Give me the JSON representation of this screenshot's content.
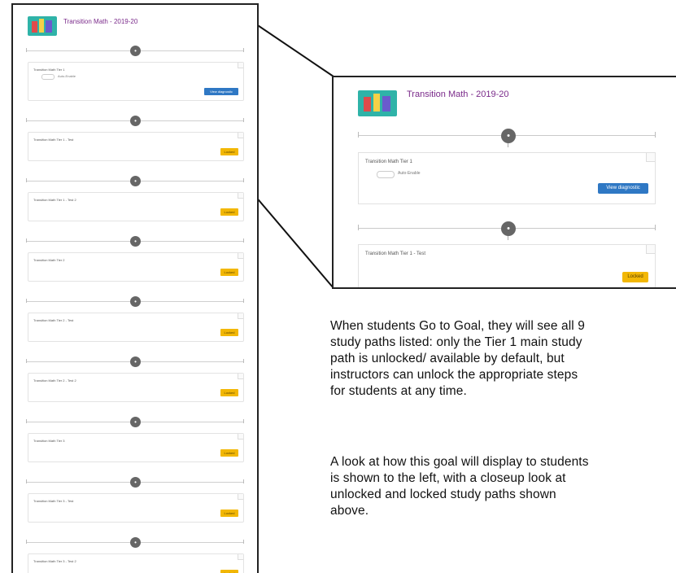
{
  "goal_title": "Transition Math - 2019-20",
  "left_panel": {
    "cards": [
      {
        "title": "Transition Math Tier 1",
        "toggle_label": "Auto-Enable",
        "button": "View diagnostic",
        "unlocked": true
      },
      {
        "title": "Transition Math Tier 1 - Test",
        "button": "Locked",
        "unlocked": false
      },
      {
        "title": "Transition Math Tier 1 - Test 2",
        "button": "Locked",
        "unlocked": false
      },
      {
        "title": "Transition Math Tier 2",
        "button": "Locked",
        "unlocked": false
      },
      {
        "title": "Transition Math Tier 2 - Test",
        "button": "Locked",
        "unlocked": false
      },
      {
        "title": "Transition Math Tier 2 - Test 2",
        "button": "Locked",
        "unlocked": false
      },
      {
        "title": "Transition Math Tier 3",
        "button": "Locked",
        "unlocked": false
      },
      {
        "title": "Transition Math Tier 3 - Test",
        "button": "Locked",
        "unlocked": false
      },
      {
        "title": "Transition Math Tier 3 - Test 2",
        "button": "Locked",
        "unlocked": false
      }
    ]
  },
  "zoom_panel": {
    "card1_title": "Transition Math Tier 1",
    "card1_toggle_label": "Auto-Enable",
    "card1_button": "View diagnostic",
    "card2_title": "Transition Math Tier 1 - Test",
    "card2_button": "Locked"
  },
  "description": {
    "paragraph1": "When students Go to Goal, they will see all 9\nstudy paths listed: only the Tier 1 main study\npath is unlocked/ available by default, but\ninstructors can unlock the appropriate steps\nfor students at any time.",
    "paragraph2": "A look at how this goal will display to students\nis shown to the left, with a closeup look at\nunlocked and locked study paths shown\nabove."
  },
  "colors": {
    "title_purple": "#7a2a8a",
    "unlock_button_blue": "#2f78c4",
    "locked_button_yellow": "#f2b705",
    "knob_gray": "#666666"
  },
  "icons": [
    "goal-logo-icon",
    "lock-icon",
    "step-marker-icon"
  ]
}
